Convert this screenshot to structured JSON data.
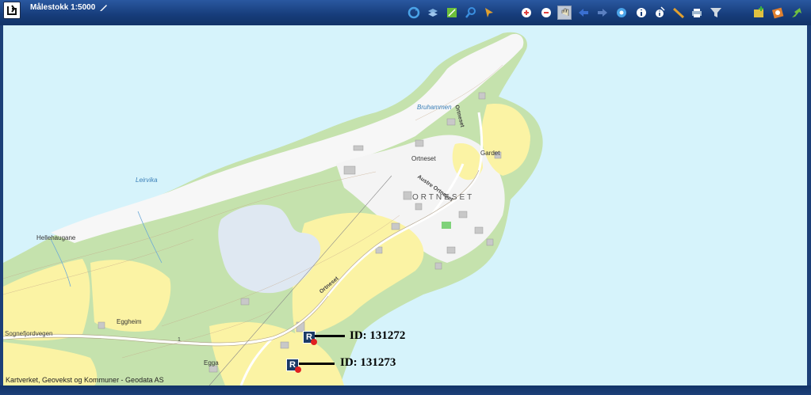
{
  "toolbar": {
    "scale_label": "Målestokk 1:5000",
    "tools": [
      {
        "name": "refresh-icon",
        "color": "#4aa3e8"
      },
      {
        "name": "layers-icon",
        "color": "#7fb0e0"
      },
      {
        "name": "map-select-icon",
        "color": "#6cbf3a"
      },
      {
        "name": "search-icon",
        "color": "#3a8fe0"
      },
      {
        "name": "pointer-icon",
        "color": "#e0a030"
      },
      {
        "name": "draw-line-icon",
        "color": "#d0a040"
      },
      {
        "name": "zoom-in-icon",
        "color": "#e04040"
      },
      {
        "name": "zoom-out-icon",
        "color": "#e04040"
      },
      {
        "name": "pan-hand-icon",
        "color": "#e8e0c0"
      },
      {
        "name": "back-arrow-icon",
        "color": "#3a6fd0"
      },
      {
        "name": "forward-arrow-icon",
        "color": "#5a7fc0"
      },
      {
        "name": "zoom-extent-icon",
        "color": "#4aa3e8"
      },
      {
        "name": "info-icon",
        "color": "#ffffff"
      },
      {
        "name": "identify-icon",
        "color": "#ffffff"
      },
      {
        "name": "measure-icon",
        "color": "#e0a030"
      },
      {
        "name": "print-icon",
        "color": "#a0b8d0"
      },
      {
        "name": "filter-icon",
        "color": "#d0d8e0"
      },
      {
        "name": "add-layer-icon",
        "color": "#e0c040"
      },
      {
        "name": "settings-icon",
        "color": "#e08030"
      },
      {
        "name": "export-icon",
        "color": "#70c040"
      }
    ]
  },
  "map": {
    "place_names": {
      "hellehaugane": "Hellehaugane",
      "leirvika": "Leirvika",
      "bruhammen": "Bruhammen",
      "ortneset_small": "Ortneset",
      "ortneset_big": "ORTNESET",
      "gardet": "Gardet",
      "eggheim": "Eggheim",
      "egga": "Egga"
    },
    "road_names": {
      "sognefjordvegen": "Sognefjordvegen",
      "ortneset_road_north": "Ortneset",
      "austre_ortneset": "Austre Ortneset",
      "ortneset_road_south": "Ortneset",
      "route_number": "1"
    },
    "attribution": "Kartverket, Geovekst og Kommuner - Geodata AS",
    "colors": {
      "sea": "#d6f3fb",
      "forest": "#c5e2ad",
      "farmland": "#fbf3a4",
      "bare": "#f7f7f7",
      "marsh": "#dfe8f2",
      "urban": "#e3e3e3",
      "marker": "#1b3a66",
      "marker_dot": "#e02020"
    }
  },
  "markers": [
    {
      "id_text": "ID: 131272",
      "icon": "marker-r-icon",
      "glyph": "R"
    },
    {
      "id_text": "ID: 131273",
      "icon": "marker-r-icon",
      "glyph": "R"
    }
  ]
}
